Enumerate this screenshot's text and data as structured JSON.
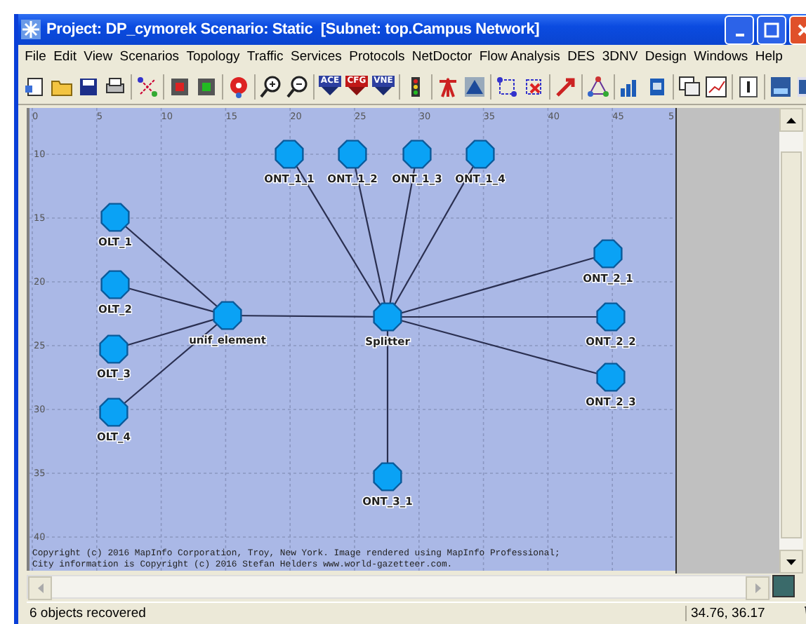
{
  "window": {
    "title": "Project: DP_cymorek Scenario: Static  [Subnet: top.Campus Network]"
  },
  "menu": [
    "File",
    "Edit",
    "View",
    "Scenarios",
    "Topology",
    "Traffic",
    "Services",
    "Protocols",
    "NetDoctor",
    "Flow Analysis",
    "DES",
    "3DNV",
    "Design",
    "Windows",
    "Help"
  ],
  "toolbar": {
    "badges": [
      "ACE",
      "CFG",
      "VNE"
    ]
  },
  "canvas": {
    "x_ruler": [
      "0",
      "5",
      "10",
      "15",
      "20",
      "25",
      "30",
      "35",
      "40",
      "45",
      "5"
    ],
    "y_ruler": [
      "10",
      "15",
      "20",
      "25",
      "30",
      "35",
      "40"
    ],
    "nodes": [
      {
        "label": "OLT_1"
      },
      {
        "label": "OLT_2"
      },
      {
        "label": "OLT_3"
      },
      {
        "label": "OLT_4"
      },
      {
        "label": "unif_element"
      },
      {
        "label": "Splitter"
      },
      {
        "label": "ONT_1_1"
      },
      {
        "label": "ONT_1_2"
      },
      {
        "label": "ONT_1_3"
      },
      {
        "label": "ONT_1_4"
      },
      {
        "label": "ONT_2_1"
      },
      {
        "label": "ONT_2_2"
      },
      {
        "label": "ONT_2_3"
      },
      {
        "label": "ONT_3_1"
      }
    ],
    "copyright": [
      "Copyright (c) 2016 MapInfo Corporation, Troy, New York. Image rendered using MapInfo Professional;",
      "City information is Copyright (c) 2016 Stefan Helders www.world-gazetteer.com."
    ]
  },
  "status_bar": {
    "message": "6 objects recovered",
    "coordinates": "34.76, 36.17"
  }
}
